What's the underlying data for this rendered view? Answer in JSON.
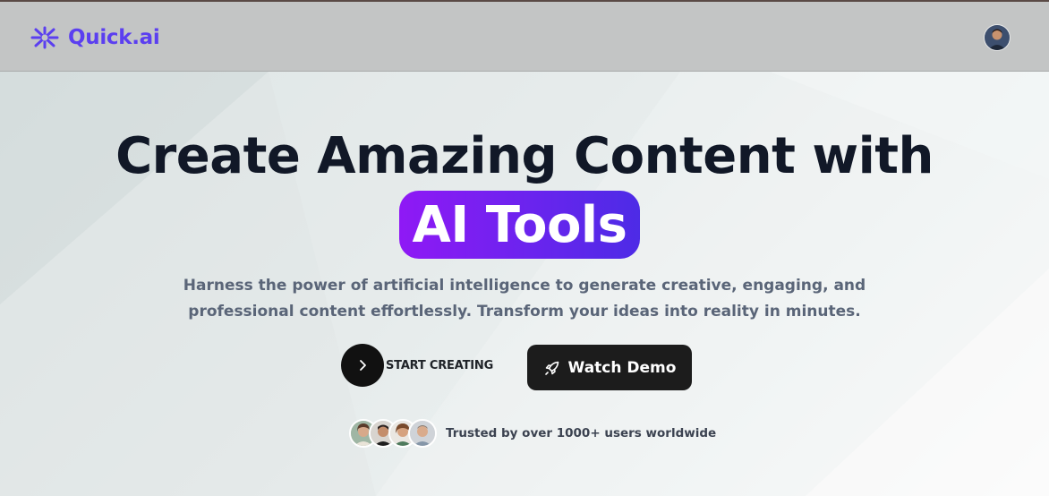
{
  "nav": {
    "brand": "Quick.ai",
    "brand_color": "#5b3ff0",
    "logo_icon": "sparkle-asterisk-icon",
    "avatar_icon": "user-avatar"
  },
  "hero": {
    "headline": "Create Amazing Content with",
    "highlight": "AI Tools",
    "highlight_gradient": [
      "#8f19f5",
      "#4d2be6"
    ],
    "subtitle": "Harness the power of artificial intelligence to generate creative, engaging, and professional content effortlessly. Transform your ideas into reality in minutes."
  },
  "actions": {
    "start_label": "START CREATING",
    "start_icon": "chevron-right-icon",
    "demo_label": "Watch Demo",
    "demo_icon": "rocket-icon"
  },
  "trust": {
    "text": "Trusted by over 1000+ users worldwide",
    "avatar_count": 4
  }
}
